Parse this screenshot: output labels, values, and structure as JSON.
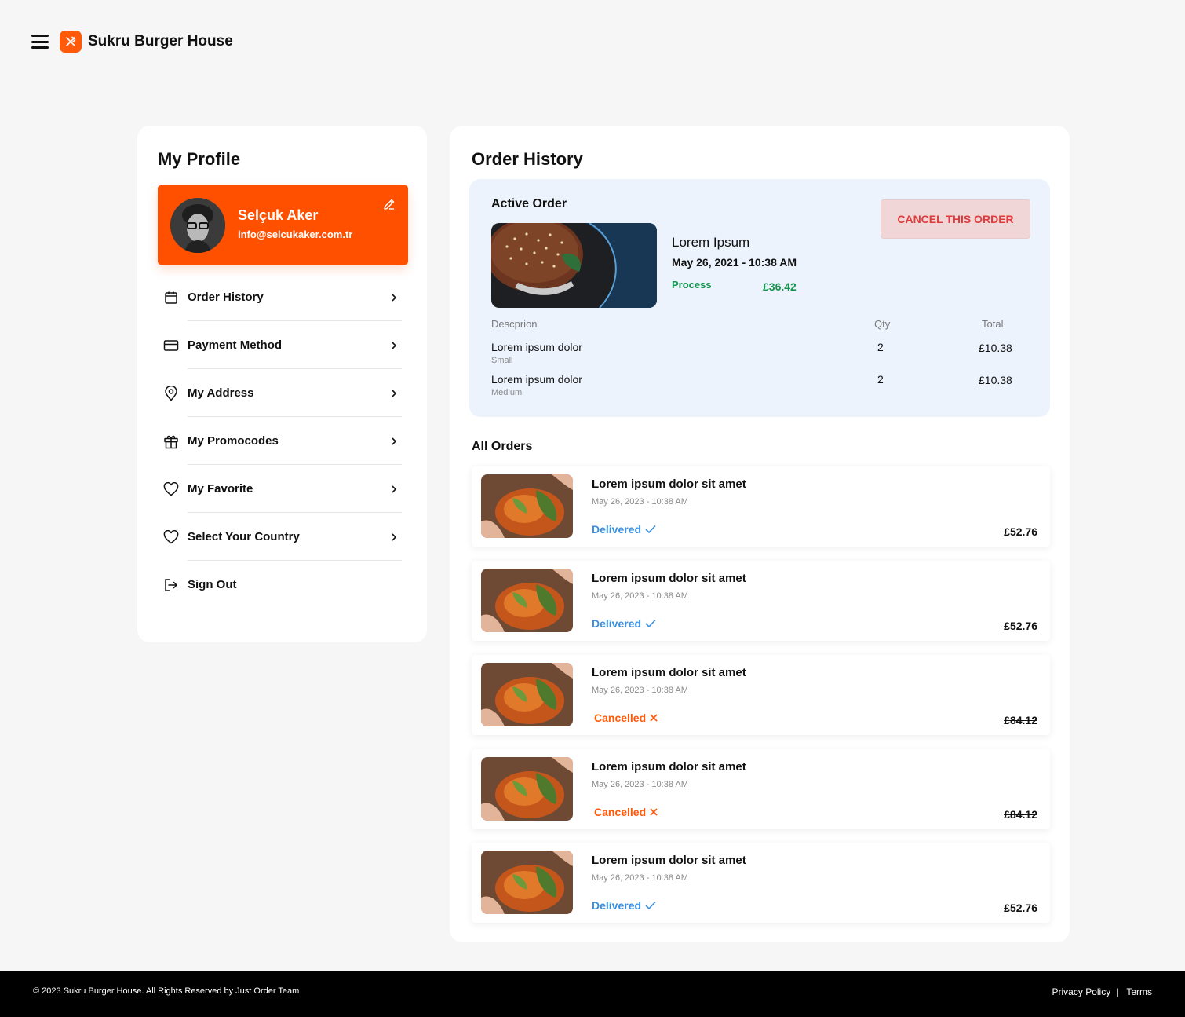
{
  "header": {
    "brand": "Sukru Burger House",
    "menu_icon": "hamburger-icon",
    "logo_icon": "utensils-icon"
  },
  "colors": {
    "accent": "#ff5000",
    "success": "#17954f",
    "delivered": "#3a8fe0",
    "cancelled": "#ff5a0a",
    "cancel_button_bg": "#f0d6d6",
    "cancel_button_text": "#e03b3b",
    "active_box_bg": "#ecf3fd"
  },
  "profile": {
    "title": "My Profile",
    "name": "Selçuk Aker",
    "email": "info@selcukaker.com.tr",
    "edit_icon": "pencil-icon"
  },
  "menu": {
    "items": [
      {
        "label": "Order History",
        "icon": "calendar-icon"
      },
      {
        "label": "Payment Method",
        "icon": "credit-card-icon"
      },
      {
        "label": "My Address",
        "icon": "location-pin-icon"
      },
      {
        "label": "My Promocodes",
        "icon": "gift-icon"
      },
      {
        "label": "My Favorite",
        "icon": "heart-icon"
      },
      {
        "label": "Select Your Country",
        "icon": "heart-icon"
      },
      {
        "label": "Sign Out",
        "icon": "sign-out-icon"
      }
    ]
  },
  "orders": {
    "title": "Order History",
    "active": {
      "label": "Active Order",
      "cancel_label": "CANCEL THIS ORDER",
      "name": "Lorem Ipsum",
      "date": "May 26, 2021 - 10:38 AM",
      "status": "Process",
      "price": "£36.42",
      "table": {
        "headers": {
          "description": "Descprion",
          "qty": "Qty",
          "total": "Total"
        },
        "rows": [
          {
            "name": "Lorem ipsum dolor",
            "size": "Small",
            "qty": "2",
            "total": "£10.38"
          },
          {
            "name": "Lorem ipsum dolor",
            "size": "Medium",
            "qty": "2",
            "total": "£10.38"
          }
        ]
      }
    },
    "all_label": "All Orders",
    "list": [
      {
        "title": "Lorem ipsum dolor sit amet",
        "date": "May 26, 2023 - 10:38 AM",
        "status": "Delivered",
        "price": "£52.76"
      },
      {
        "title": "Lorem ipsum dolor sit amet",
        "date": "May 26, 2023 - 10:38 AM",
        "status": "Delivered",
        "price": "£52.76"
      },
      {
        "title": "Lorem ipsum dolor sit amet",
        "date": "May 26, 2023 - 10:38 AM",
        "status": "Cancelled",
        "price": "£84.12"
      },
      {
        "title": "Lorem ipsum dolor sit amet",
        "date": "May 26, 2023 - 10:38 AM",
        "status": "Cancelled",
        "price": "£84.12"
      },
      {
        "title": "Lorem ipsum dolor sit amet",
        "date": "May 26, 2023 - 10:38 AM",
        "status": "Delivered",
        "price": "£52.76"
      }
    ]
  },
  "footer": {
    "copyright": "© 2023 Sukru Burger House. All Rights Reserved by Just Order Team",
    "privacy": "Privacy Policy",
    "separator": "|",
    "terms": "Terms"
  }
}
